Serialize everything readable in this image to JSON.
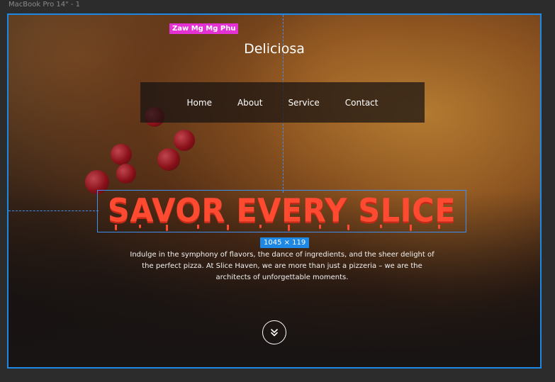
{
  "frame": {
    "label": "MacBook Pro 14\" - 1"
  },
  "editor": {
    "name_tag": "Zaw Mg Mg Phu",
    "selection_dims": "1045 × 119"
  },
  "site": {
    "brand": "Deliciosa",
    "nav": [
      "Home",
      "About",
      "Service",
      "Contact"
    ],
    "headline": "SAVOR EVERY SLICE",
    "subtext": "Indulge in the symphony of flavors, the dance of ingredients, and the sheer delight of the perfect pizza. At Slice Haven, we are more than just a pizzeria – we are the architects of unforgettable moments.",
    "scroll_icon": "double-chevron-down-icon"
  },
  "colors": {
    "selection": "#1e88e5",
    "name_tag": "#e431d4",
    "headline": "#ff4a32"
  }
}
